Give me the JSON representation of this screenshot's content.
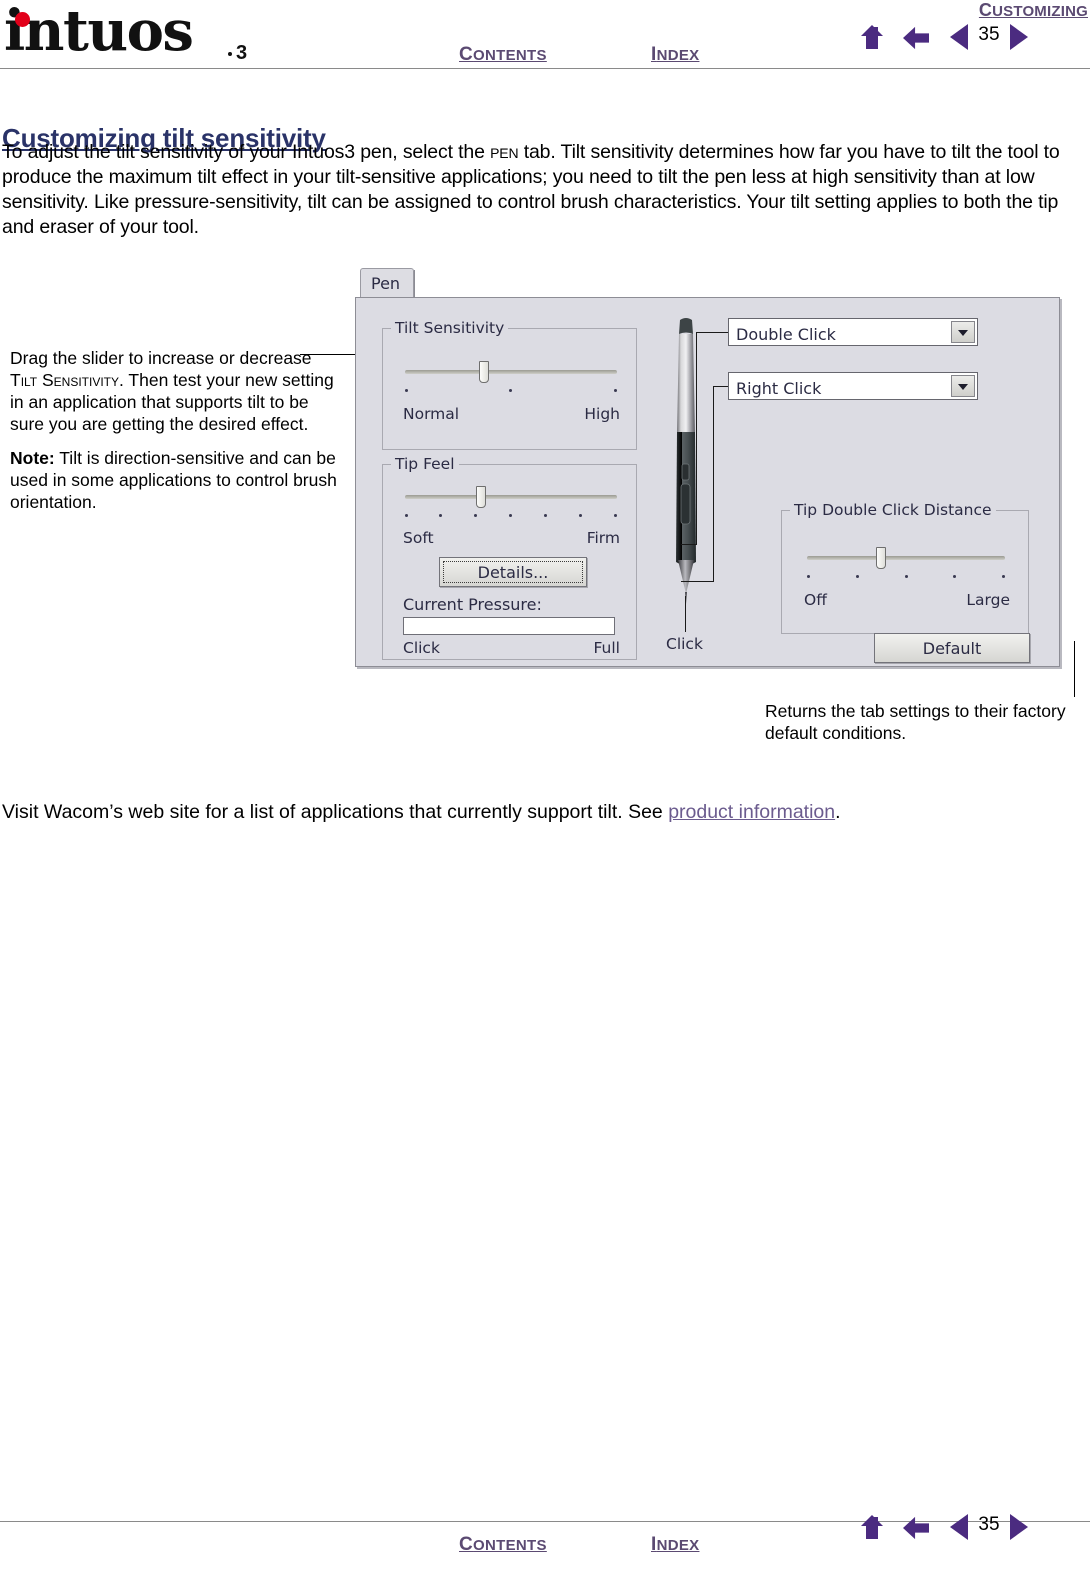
{
  "header": {
    "logo_word": "intuos",
    "logo_suffix": "3",
    "chapter_link": "CUSTOMIZING",
    "contents_link": "CONTENTS",
    "index_link": "INDEX",
    "page_number": "35",
    "icons": {
      "home": "home-icon",
      "back": "back-arrow-icon",
      "prev": "previous-page-icon",
      "next": "next-page-icon"
    }
  },
  "content": {
    "heading": "Customizing tilt sensitivity",
    "intro_paragraph": "To adjust the tilt sensitivity of your Intuos3 pen, select the PEN tab.  Tilt sensitivity determines how far you have to tilt the tool to produce the maximum tilt effect in your tilt-sensitive applications; you need to tilt the pen less at high sensitivity than at low sensitivity.  Like pressure-sensitivity, tilt can be assigned to control brush characteristics.  Your tilt setting applies to both the tip and eraser of your tool.",
    "closing_text_before": "Visit Wacom’s web site for a list of applications that currently support tilt.  See ",
    "closing_link": "product information",
    "closing_text_after": "."
  },
  "callouts": {
    "left": {
      "para1_a": "Drag the slider to increase or decrease ",
      "para1_smallcaps": "Tilt Sensitivity",
      "para1_b": ".  Then test your new setting in an application that supports tilt to be sure you are getting the desired effect.",
      "note_label": "Note:",
      "note_text": " Tilt is direction-sensitive and can be used in some applications to control brush orientation."
    },
    "right": {
      "text": "Returns the tab settings to their factory default conditions."
    }
  },
  "dialog": {
    "tab_label": "Pen",
    "tilt_sensitivity": {
      "title": "Tilt Sensitivity",
      "min_label": "Normal",
      "max_label": "High",
      "tick_count": 3,
      "value_percent": 48
    },
    "tip_feel": {
      "title": "Tip Feel",
      "min_label": "Soft",
      "max_label": "Firm",
      "tick_count": 7,
      "value_percent": 46,
      "details_button": "Details...",
      "current_pressure_label": "Current Pressure:",
      "pressure_min_label": "Click",
      "pressure_max_label": "Full",
      "pressure_percent": 0
    },
    "pen_tip_label": "Click",
    "dropdowns": [
      {
        "name": "double-click",
        "value": "Double Click"
      },
      {
        "name": "right-click",
        "value": "Right Click"
      }
    ],
    "tip_double_click_distance": {
      "title": "Tip Double Click Distance",
      "min_label": "Off",
      "max_label": "Large",
      "tick_count": 5,
      "value_percent": 50
    },
    "default_button": "Default"
  },
  "footer": {
    "contents_link": "CONTENTS",
    "index_link": "INDEX",
    "page_number": "35"
  },
  "colors": {
    "heading": "#2a3368",
    "link_purple": "#5b4a72",
    "nav_icon": "#4b2b80",
    "logo_dot_red": "#e2001a",
    "dialog_bg": "#dcdce3"
  }
}
